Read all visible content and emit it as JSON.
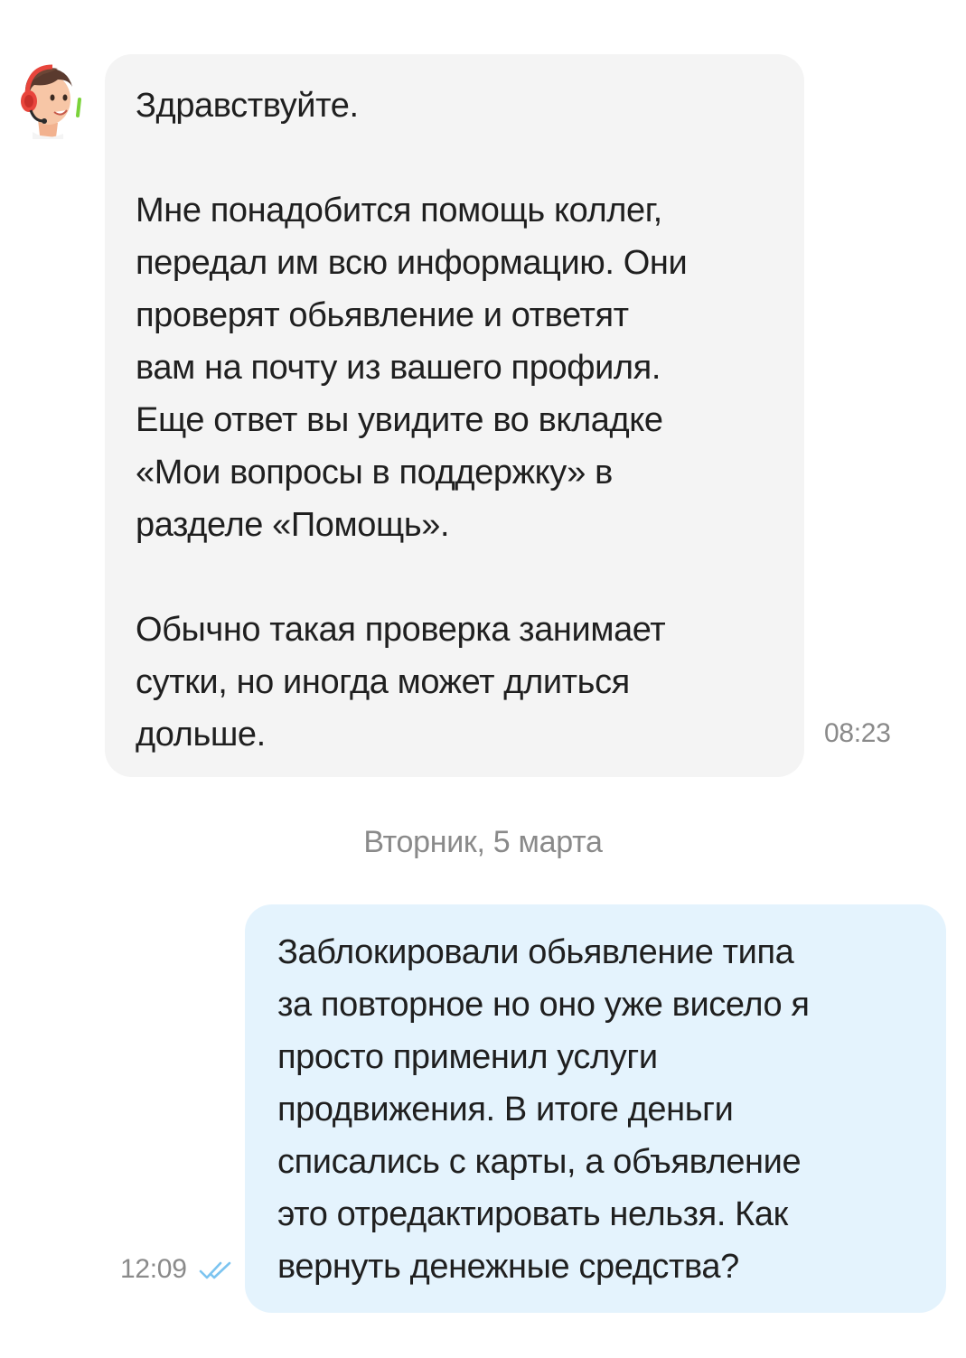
{
  "incoming_message": {
    "paragraphs": [
      "Здравствуйте.",
      "Мне понадобится помощь коллег,\nпередал им всю информацию. Они\nпроверят обьявление и ответят\nвам на почту из вашего профиля.\nЕще ответ вы увидите во вкладке\n«Мои вопросы в поддержку» в\nразделе «Помощь».",
      "Обычно такая проверка занимает\nсутки, но иногда может длиться\nдольше."
    ],
    "time": "08:23",
    "avatar_icon": "support-agent-headset-icon"
  },
  "date_separator": "Вторник, 5 марта",
  "outgoing_message": {
    "text": "Заблокировали обьявление типа\nза повторное но оно уже висело я\nпросто применил услуги\nпродвижения. В итоге деньги\nсписались с карты, а объявление\nэто отредактировать нельзя. Как\nвернуть денежные средства?",
    "time": "12:09",
    "status_icon": "double-check-read-icon"
  },
  "colors": {
    "incoming_bubble": "#f4f4f4",
    "outgoing_bubble": "#e4f3fd",
    "muted_text": "#8a8a8a",
    "read_checks": "#7cc4f0",
    "avatar_headset": "#e8453c",
    "avatar_mic_accent": "#7bd33a"
  }
}
